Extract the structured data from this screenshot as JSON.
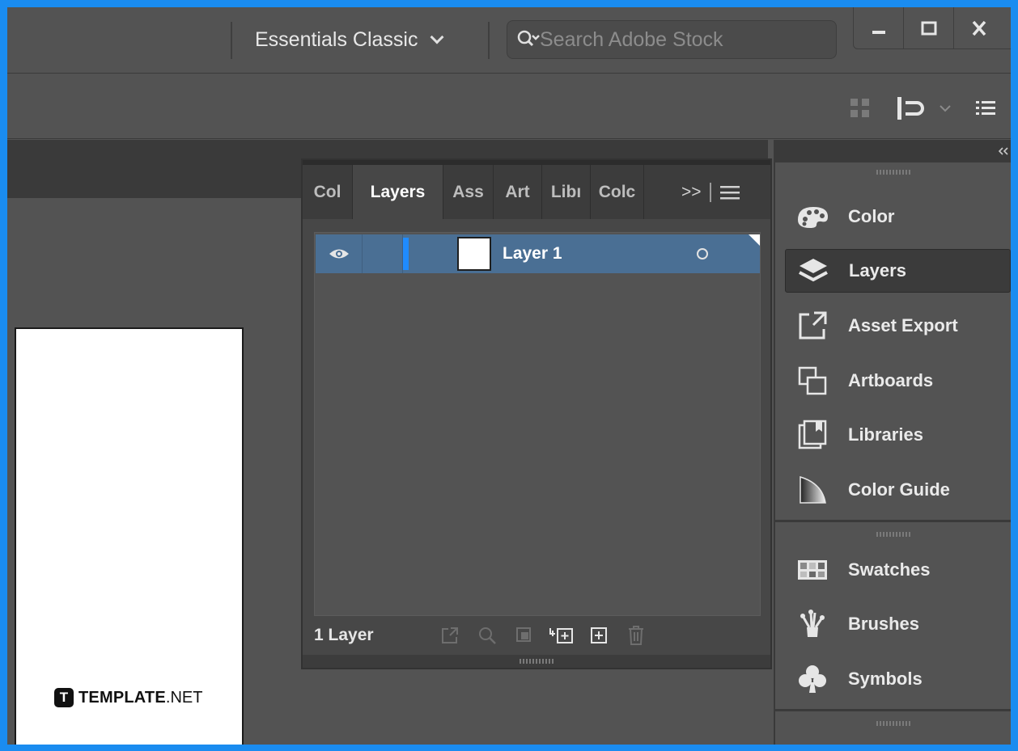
{
  "titlebar": {
    "workspace": "Essentials Classic",
    "search_placeholder": "Search Adobe Stock"
  },
  "layers_panel": {
    "tabs": [
      {
        "label": "Col",
        "active": false
      },
      {
        "label": "Layers",
        "active": true
      },
      {
        "label": "Ass",
        "active": false
      },
      {
        "label": "Art",
        "active": false
      },
      {
        "label": "Libı",
        "active": false
      },
      {
        "label": "Colc",
        "active": false
      }
    ],
    "overflow_label": ">>",
    "layer": {
      "name": "Layer 1",
      "color": "#1f8bff"
    },
    "count_label": "1 Layer"
  },
  "dock": {
    "items": [
      {
        "label": "Color",
        "icon": "palette-icon"
      },
      {
        "label": "Layers",
        "icon": "layers-icon",
        "active": true
      },
      {
        "label": "Asset Export",
        "icon": "asset-export-icon"
      },
      {
        "label": "Artboards",
        "icon": "artboards-icon"
      },
      {
        "label": "Libraries",
        "icon": "libraries-icon"
      },
      {
        "label": "Color Guide",
        "icon": "color-guide-icon"
      },
      {
        "label": "Swatches",
        "icon": "swatches-icon"
      },
      {
        "label": "Brushes",
        "icon": "brushes-icon"
      },
      {
        "label": "Symbols",
        "icon": "symbols-icon"
      }
    ]
  },
  "watermark": {
    "brand_bold": "TEMPLATE",
    "brand_suffix": ".NET"
  },
  "colors": {
    "accent": "#1a8cf0",
    "selection": "#4a6f94",
    "panel": "#535353"
  }
}
